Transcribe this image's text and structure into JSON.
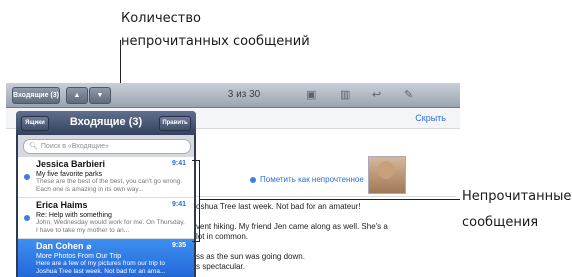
{
  "annotations": {
    "unread_count_line1": "Количество",
    "unread_count_line2": "непрочитанных сообщений",
    "unread_msgs_line1": "Непрочитанные",
    "unread_msgs_line2": "сообщения"
  },
  "toolbar": {
    "inbox_button": "Входящие (3)",
    "title": "3 из 30"
  },
  "detail": {
    "hide_label": "Скрыть",
    "mark_unread": "Пометить как непрочтенное",
    "body_lines": [
      "oshua Tree last week. Not bad for an amateur!",
      "vent hiking. My friend Jen came along as well. She's a",
      "lot in common.",
      "ss as the sun was going down.",
      "s spectacular."
    ]
  },
  "popover": {
    "mailboxes_button": "Ящики",
    "title": "Входящие (3)",
    "edit_button": "Править",
    "search_placeholder": "Поиск в «Входящие»"
  },
  "messages": [
    {
      "sender": "Jessica Barbieri",
      "time": "9:41",
      "subject": "My five favorite parks",
      "preview": "These are the best of the best, you can't go wrong. Each one is amazing in its own way...",
      "unread": true,
      "selected": false
    },
    {
      "sender": "Erica Haims",
      "time": "9:41",
      "subject": "Re: Help with something",
      "preview": "John, Wednesday would work for me. On Thursday, I have to take my mother to an...",
      "unread": true,
      "selected": false
    },
    {
      "sender": "Dan Cohen",
      "time": "9:35",
      "subject": "More Photos From Our Trip",
      "preview": "Here are a few of my pictures from our trip to Joshua Tree last week. Not bad for an ama...",
      "unread": false,
      "selected": true
    }
  ],
  "colors": {
    "accent": "#2f6fd6",
    "selection": "#2166d8",
    "unread_dot": "#3d7ee3"
  }
}
